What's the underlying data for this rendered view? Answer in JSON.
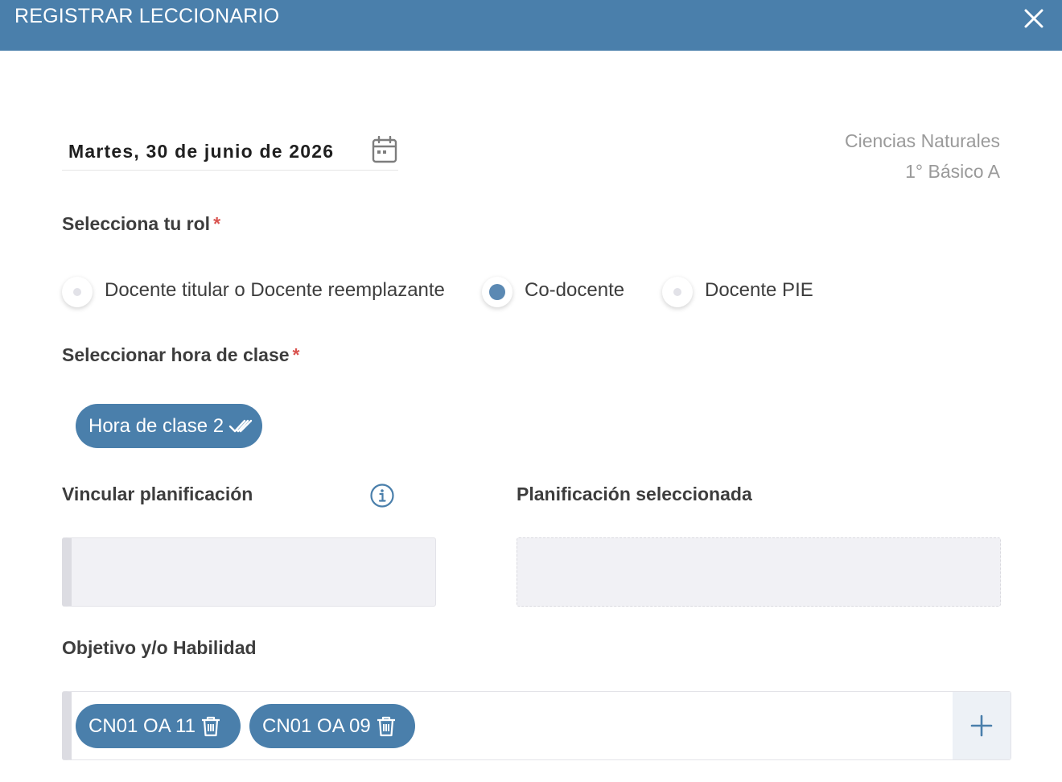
{
  "header": {
    "title": "REGISTRAR LECCIONARIO"
  },
  "date": {
    "value": "Martes, 30 de junio de 2026"
  },
  "course": {
    "subject": "Ciencias Naturales",
    "grade": "1° Básico A"
  },
  "role": {
    "label": "Selecciona tu rol",
    "required_mark": "*",
    "options": [
      {
        "label": "Docente titular o Docente reemplazante",
        "selected": false
      },
      {
        "label": "Co-docente",
        "selected": true
      },
      {
        "label": "Docente PIE",
        "selected": false
      }
    ]
  },
  "class_hour": {
    "label": "Seleccionar hora de clase",
    "required_mark": "*",
    "selected": "Hora de clase 2"
  },
  "planning": {
    "link_label": "Vincular planificación",
    "selected_label": "Planificación seleccionada"
  },
  "objectives": {
    "label": "Objetivo y/o Habilidad",
    "items": [
      "CN01 OA 11",
      "CN01 OA 09"
    ]
  },
  "colors": {
    "header": "#4a7fab",
    "accent": "#4a7fab",
    "required": "#d9534f"
  },
  "icons": [
    "close-icon",
    "calendar-icon",
    "double-check-icon",
    "info-icon",
    "trash-icon",
    "plus-icon"
  ]
}
